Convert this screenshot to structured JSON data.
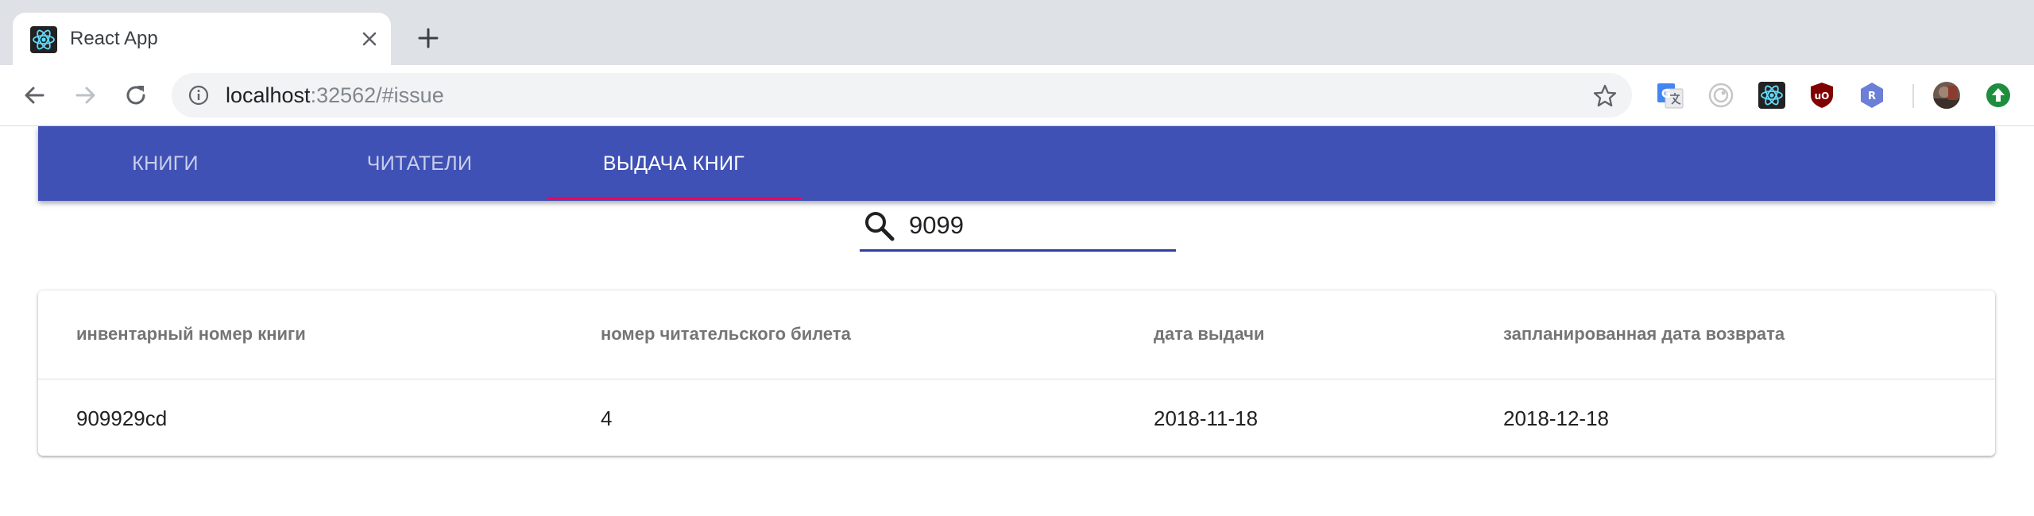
{
  "browser": {
    "tab": {
      "title": "React App",
      "favicon": "react-icon"
    },
    "url": {
      "host": "localhost",
      "rest": ":32562/#issue"
    },
    "extensions": [
      "google-translate-icon",
      "circle-extension-icon",
      "react-devtools-icon",
      "ublock-origin-icon",
      "r-extension-icon",
      "profile-avatar",
      "update-arrow-icon"
    ],
    "colors": {
      "tabstrip": "#dee1e6",
      "omnibox": "#f1f3f4"
    }
  },
  "app": {
    "nav": {
      "tabs": [
        {
          "label": "КНИГИ"
        },
        {
          "label": "ЧИТАТЕЛИ"
        },
        {
          "label": "ВЫДАЧА КНИГ"
        }
      ],
      "active_index": 2
    },
    "search": {
      "value": "9099",
      "icon": "search-icon"
    },
    "table": {
      "columns": [
        "инвентарный номер книги",
        "номер читательского билета",
        "дата выдачи",
        "запланированная дата возврата"
      ],
      "rows": [
        [
          "909929cd",
          "4",
          "2018-11-18",
          "2018-12-18"
        ]
      ]
    },
    "colors": {
      "appbar": "#3f51b5",
      "indicator": "#f50057",
      "search_underline": "#303f9f"
    }
  }
}
